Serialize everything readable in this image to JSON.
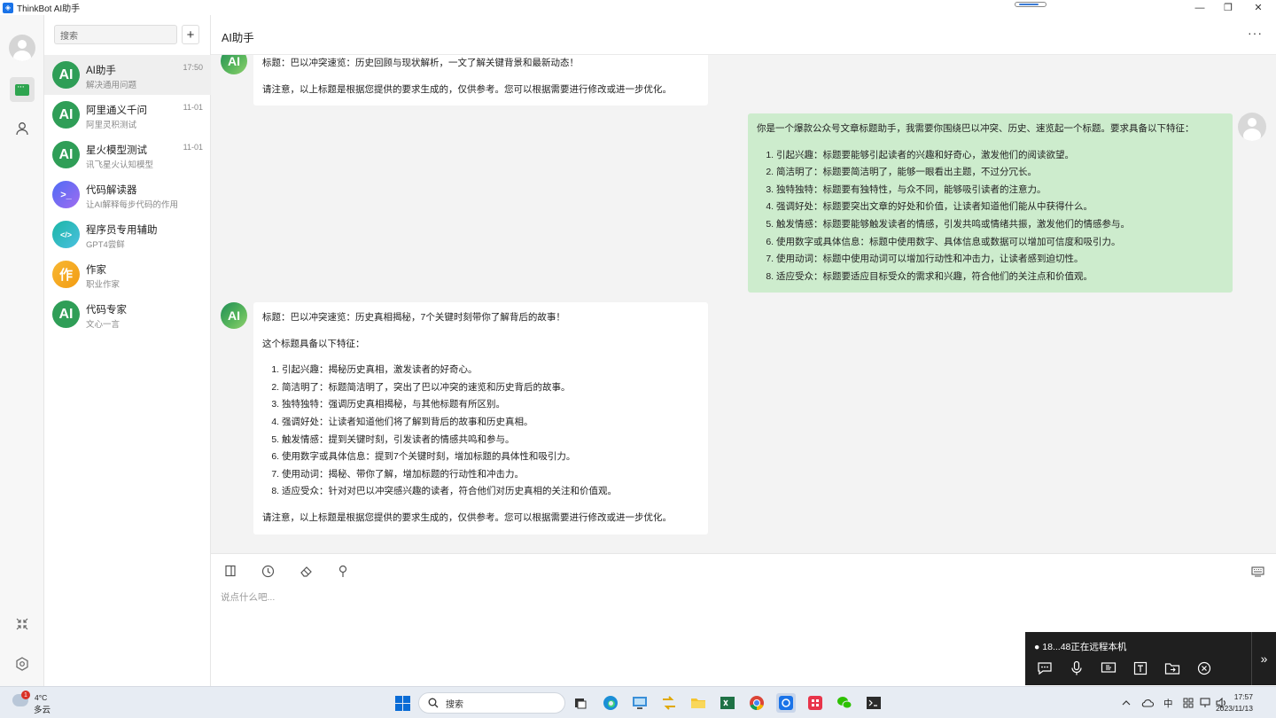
{
  "window": {
    "title": "ThinkBot AI助手",
    "minimize_glyph": "—",
    "maximize_glyph": "❐",
    "close_glyph": "✕"
  },
  "sidebar": {
    "search_placeholder": "搜索",
    "add_label": "+",
    "conversations": [
      {
        "avatar": "AI",
        "name": "AI助手",
        "sub": "解决通用问题",
        "time": "17:50",
        "color": "#2f9e57"
      },
      {
        "avatar": "AI",
        "name": "阿里通义千问",
        "sub": "阿里灵积测试",
        "time": "11-01",
        "color": "#2f9e57"
      },
      {
        "avatar": "AI",
        "name": "星火模型测试",
        "sub": "讯飞星火认知模型",
        "time": "11-01",
        "color": "#2f9e57"
      },
      {
        "avatar": ">_",
        "name": "代码解读器",
        "sub": "让AI解释每步代码的作用",
        "time": "",
        "color": "#6f6cf0"
      },
      {
        "avatar": "</>",
        "name": "程序员专用辅助",
        "sub": "GPT4尝鲜",
        "time": "",
        "color": "#27b6a8"
      },
      {
        "avatar": "作",
        "name": "作家",
        "sub": "职业作家",
        "time": "",
        "color": "#f5a623"
      },
      {
        "avatar": "AI",
        "name": "代码专家",
        "sub": "文心一言",
        "time": "",
        "color": "#2f9e57"
      }
    ]
  },
  "chat": {
    "title": "AI助手",
    "more": "···",
    "ai_avatar": "AI",
    "msg1": {
      "line1": "标题：巴以冲突速览：历史回顾与现状解析，一文了解关键背景和最新动态！",
      "line2": "请注意，以上标题是根据您提供的要求生成的，仅供参考。您可以根据需要进行修改或进一步优化。"
    },
    "user_msg": {
      "intro": "你是一个爆款公众号文章标题助手，我需要你围绕巴以冲突、历史、速览起一个标题。要求具备以下特征：",
      "items": [
        "引起兴趣：标题要能够引起读者的兴趣和好奇心，激发他们的阅读欲望。",
        "简洁明了：标题要简洁明了，能够一眼看出主题，不过分冗长。",
        "独特独特：标题要有独特性，与众不同，能够吸引读者的注意力。",
        "强调好处：标题要突出文章的好处和价值，让读者知道他们能从中获得什么。",
        "触发情感：标题要能够触发读者的情感，引发共鸣或情绪共振，激发他们的情感参与。",
        "使用数字或具体信息：标题中使用数字、具体信息或数据可以增加可信度和吸引力。",
        "使用动词：标题中使用动词可以增加行动性和冲击力，让读者感到迫切性。",
        "适应受众：标题要适应目标受众的需求和兴趣，符合他们的关注点和价值观。"
      ]
    },
    "msg2": {
      "title_line": "标题：巴以冲突速览：历史真相揭秘，7个关键时刻带你了解背后的故事！",
      "features_intro": "这个标题具备以下特征：",
      "items": [
        "引起兴趣：揭秘历史真相，激发读者的好奇心。",
        "简洁明了：标题简洁明了，突出了巴以冲突的速览和历史背后的故事。",
        "独特独特：强调历史真相揭秘，与其他标题有所区别。",
        "强调好处：让读者知道他们将了解到背后的故事和历史真相。",
        "触发情感：提到关键时刻，引发读者的情感共鸣和参与。",
        "使用数字或具体信息：提到7个关键时刻，增加标题的具体性和吸引力。",
        "使用动词：揭秘、带你了解，增加标题的行动性和冲击力。",
        "适应受众：针对对巴以冲突感兴趣的读者，符合他们对历史真相的关注和价值观。"
      ],
      "note": "请注意，以上标题是根据您提供的要求生成的，仅供参考。您可以根据需要进行修改或进一步优化。"
    },
    "input_placeholder": "说点什么吧..."
  },
  "remote_toast": {
    "text": "18...48正在远程本机",
    "expand": "»"
  },
  "taskbar": {
    "weather_badge": "1",
    "weather_temp": "4°C",
    "weather_desc": "多云",
    "search_label": "搜索",
    "ime": "中",
    "time": "17:57",
    "date": "2023/11/13"
  }
}
